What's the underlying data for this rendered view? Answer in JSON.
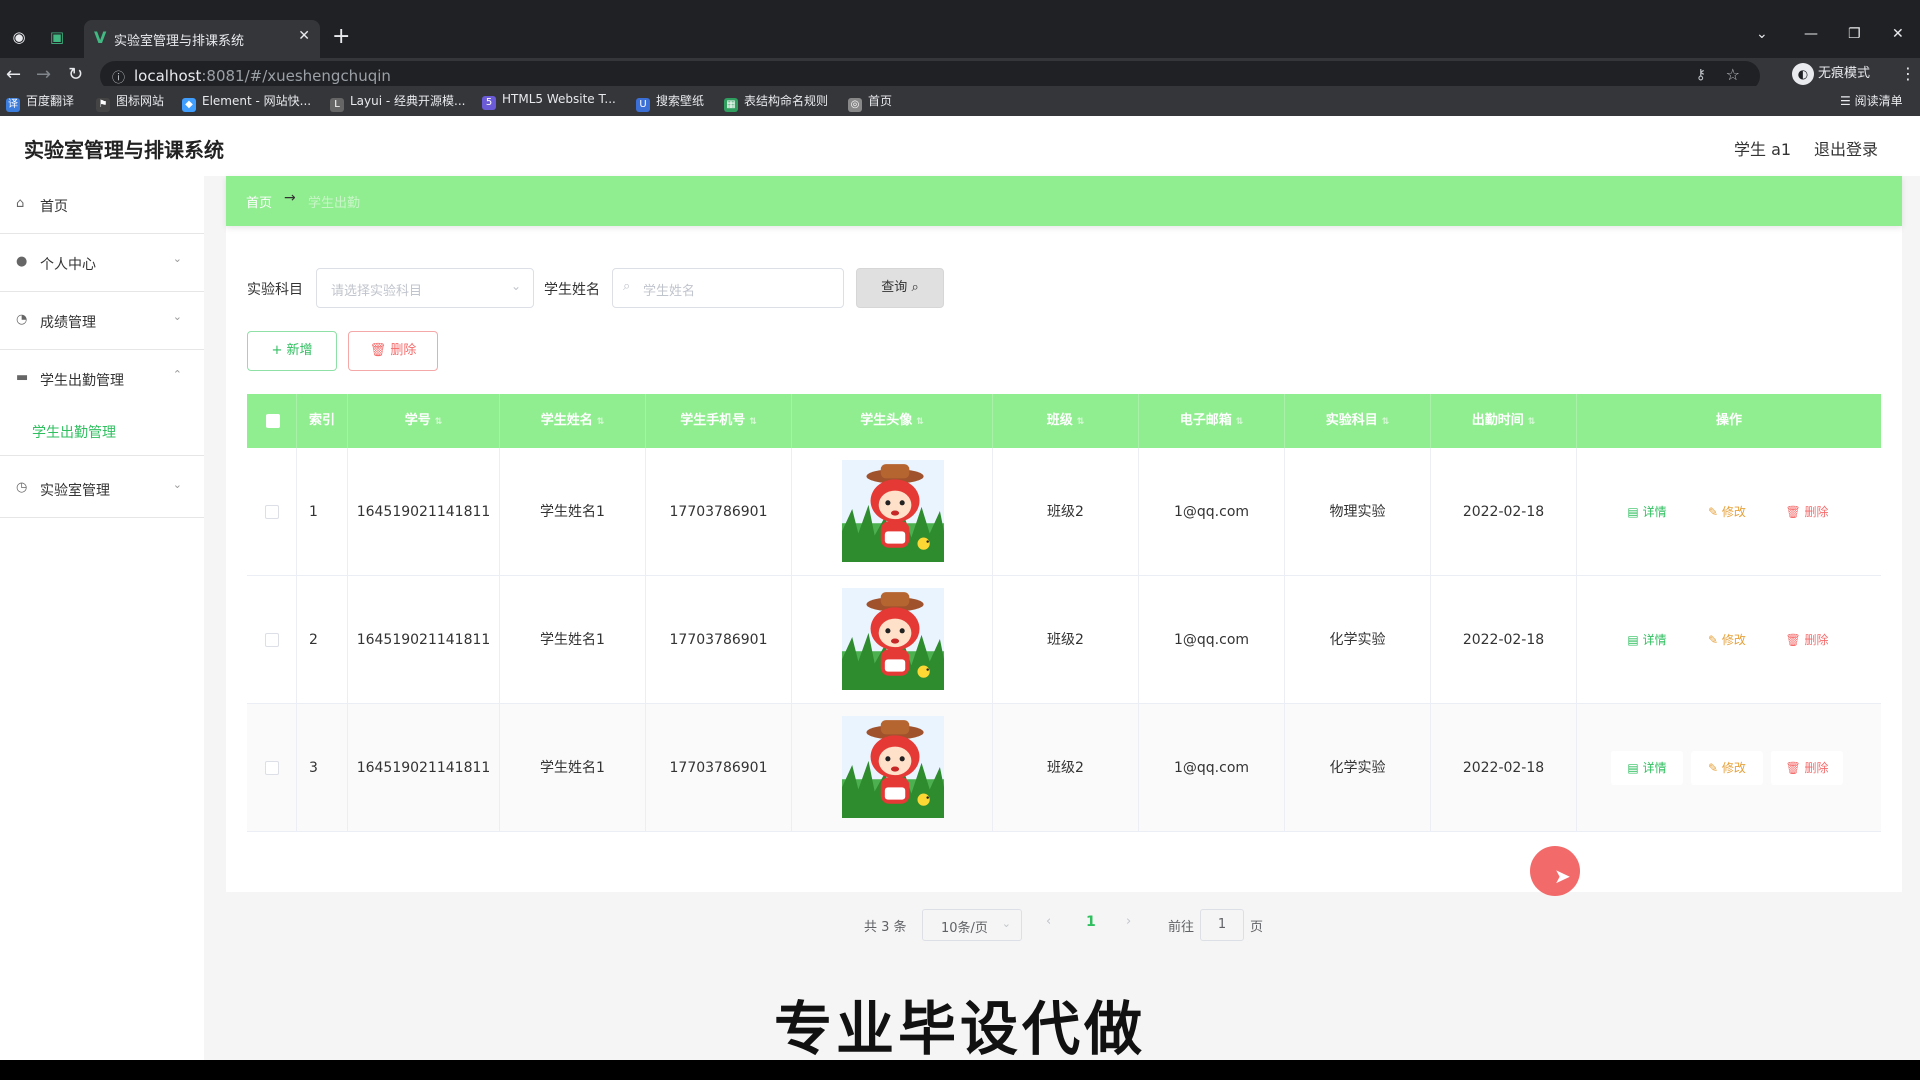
{
  "browser": {
    "tab_title": "实验室管理与排课系统",
    "url_host": "localhost",
    "url_path": ":8081/#/xueshengchuqin",
    "incognito_label": "无痕模式",
    "reading_list": "阅读清单",
    "bookmarks": [
      {
        "label": "百度翻译",
        "color": "#3b7ddd"
      },
      {
        "label": "图标网站",
        "color": "#444444"
      },
      {
        "label": "Element - 网站快...",
        "color": "#409eff"
      },
      {
        "label": "Layui - 经典开源模...",
        "color": "#666666"
      },
      {
        "label": "HTML5 Website T...",
        "color": "#6b5bd6"
      },
      {
        "label": "搜索壁纸",
        "color": "#3b6fd6"
      },
      {
        "label": "表结构命名规则",
        "color": "#2f9e5f"
      },
      {
        "label": "首页",
        "color": "#888888"
      }
    ]
  },
  "header": {
    "app_title": "实验室管理与排课系统",
    "user": "学生 a1",
    "logout": "退出登录"
  },
  "sidebar": {
    "items": [
      {
        "label": "首页",
        "icon": "home-icon"
      },
      {
        "label": "个人中心",
        "icon": "user-icon"
      },
      {
        "label": "成绩管理",
        "icon": "chart-icon"
      },
      {
        "label": "学生出勤管理",
        "icon": "briefcase-icon"
      },
      {
        "label": "实验室管理",
        "icon": "clock-icon"
      }
    ],
    "sub_item": "学生出勤管理"
  },
  "breadcrumb": {
    "home": "首页",
    "current": "学生出勤"
  },
  "search": {
    "subject_label": "实验科目",
    "subject_placeholder": "请选择实验科目",
    "name_label": "学生姓名",
    "name_placeholder": "学生姓名",
    "query_button": "查询"
  },
  "actions": {
    "add": "+ 新增",
    "delete": "删除"
  },
  "table": {
    "columns": [
      "索引",
      "学号",
      "学生姓名",
      "学生手机号",
      "学生头像",
      "班级",
      "电子邮箱",
      "实验科目",
      "出勤时间",
      "操作"
    ],
    "rows": [
      {
        "index": "1",
        "student_id": "164519021141811",
        "name": "学生姓名1",
        "phone": "17703786901",
        "class": "班级2",
        "email": "1@qq.com",
        "subject": "物理实验",
        "date": "2022-02-18"
      },
      {
        "index": "2",
        "student_id": "164519021141811",
        "name": "学生姓名1",
        "phone": "17703786901",
        "class": "班级2",
        "email": "1@qq.com",
        "subject": "化学实验",
        "date": "2022-02-18"
      },
      {
        "index": "3",
        "student_id": "164519021141811",
        "name": "学生姓名1",
        "phone": "17703786901",
        "class": "班级2",
        "email": "1@qq.com",
        "subject": "化学实验",
        "date": "2022-02-18"
      }
    ],
    "row_actions": {
      "detail": "详情",
      "edit": "修改",
      "remove": "删除"
    }
  },
  "pagination": {
    "total": "共 3 条",
    "page_size": "10条/页",
    "current": "1",
    "goto": "前往",
    "goto_value": "1",
    "page_suffix": "页"
  },
  "overlay_caption": "专业毕设代做"
}
